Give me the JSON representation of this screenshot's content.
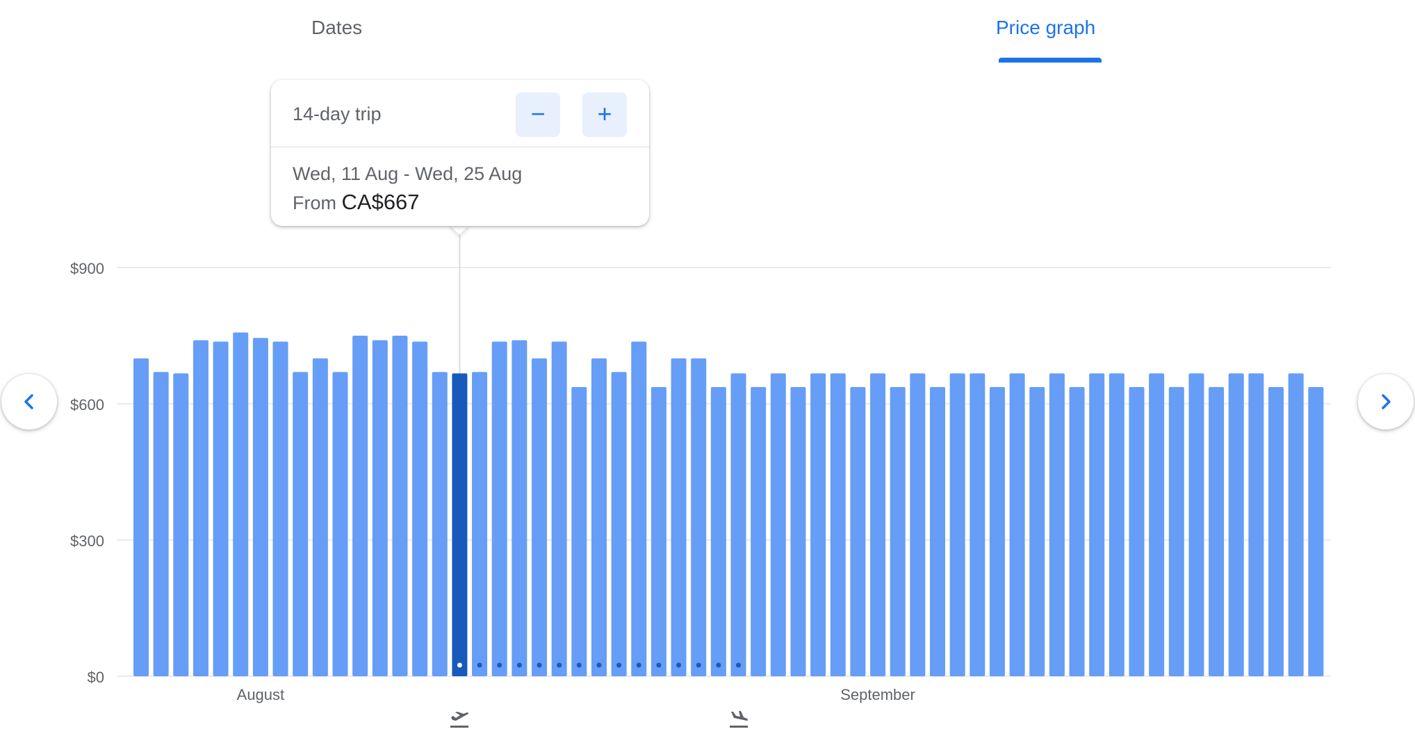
{
  "tabs": [
    {
      "label": "Dates",
      "active": false
    },
    {
      "label": "Price graph",
      "active": true
    }
  ],
  "popup": {
    "trip_length": "14-day trip",
    "decrease_label": "−",
    "increase_label": "+",
    "date_range": "Wed, 11 Aug - Wed, 25 Aug",
    "price_prefix": "From",
    "price": "CA$667"
  },
  "navigation": {
    "prev_icon": "chevron-left-icon",
    "next_icon": "chevron-right-icon"
  },
  "colors": {
    "accent": "#1a73e8",
    "bar": "#669df6",
    "bar_selected": "#185abc",
    "grid": "#e8eaed",
    "axis_text": "#5f6368"
  },
  "chart_data": {
    "type": "bar",
    "ylim": [
      0,
      900
    ],
    "yticks": [
      "$0",
      "$300",
      "$600",
      "$900"
    ],
    "ytick_values": [
      0,
      300,
      600,
      900
    ],
    "month_labels": [
      "August",
      "September"
    ],
    "month_label_bar_index": [
      6,
      37
    ],
    "selected_index": 16,
    "trip_dot_range": [
      16,
      30
    ],
    "departure_index": 16,
    "return_index": 30,
    "values": [
      700,
      670,
      667,
      740,
      737,
      757,
      745,
      737,
      670,
      700,
      670,
      750,
      740,
      750,
      737,
      670,
      667,
      670,
      737,
      740,
      700,
      737,
      637,
      700,
      670,
      737,
      637,
      700,
      700,
      637,
      667,
      637,
      667,
      637,
      667,
      667,
      637,
      667,
      637,
      667,
      637,
      667,
      667,
      637,
      667,
      637,
      667,
      637,
      667,
      667,
      637,
      667,
      637,
      667,
      637,
      667,
      667,
      637,
      667,
      637
    ]
  }
}
